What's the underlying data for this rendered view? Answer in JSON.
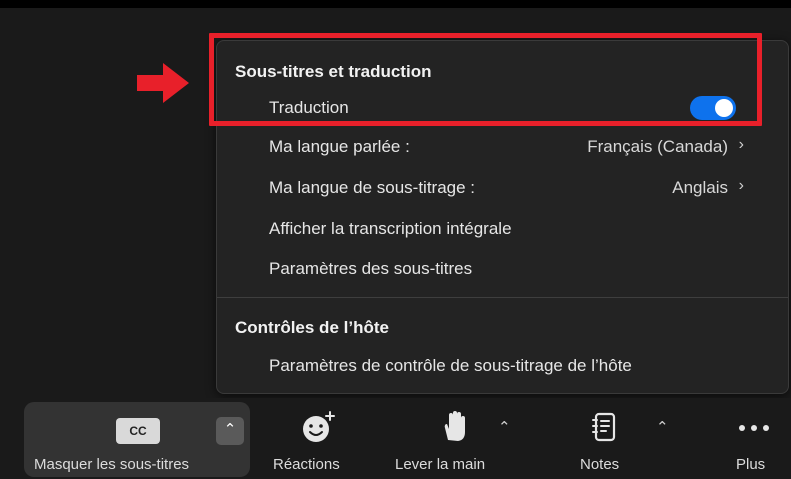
{
  "menu": {
    "heading_captions": "Sous-titres et traduction",
    "translation_label": "Traduction",
    "translation_enabled": true,
    "spoken_language_label": "Ma langue parlée :",
    "spoken_language_value": "Français (Canada)",
    "subtitle_language_label": "Ma langue de sous-titrage :",
    "subtitle_language_value": "Anglais",
    "full_transcript": "Afficher la transcription intégrale",
    "caption_settings": "Paramètres des sous-titres",
    "heading_host": "Contrôles de l’hôte",
    "host_caption_settings": "Paramètres de contrôle de sous-titrage de l’hôte"
  },
  "toolbar": {
    "cc_icon_text": "CC",
    "hide_captions": "Masquer les sous-titres",
    "reactions": "Réactions",
    "raise_hand": "Lever la main",
    "notes": "Notes",
    "more": "Plus"
  },
  "colors": {
    "highlight": "#e8202a",
    "toggle_on": "#0e72ed"
  },
  "icons": [
    "arrow-right-icon",
    "cc-icon",
    "chevron-up-icon",
    "reaction-face-icon",
    "raise-hand-icon",
    "notes-icon",
    "more-dots-icon",
    "chevron-right-icon"
  ]
}
